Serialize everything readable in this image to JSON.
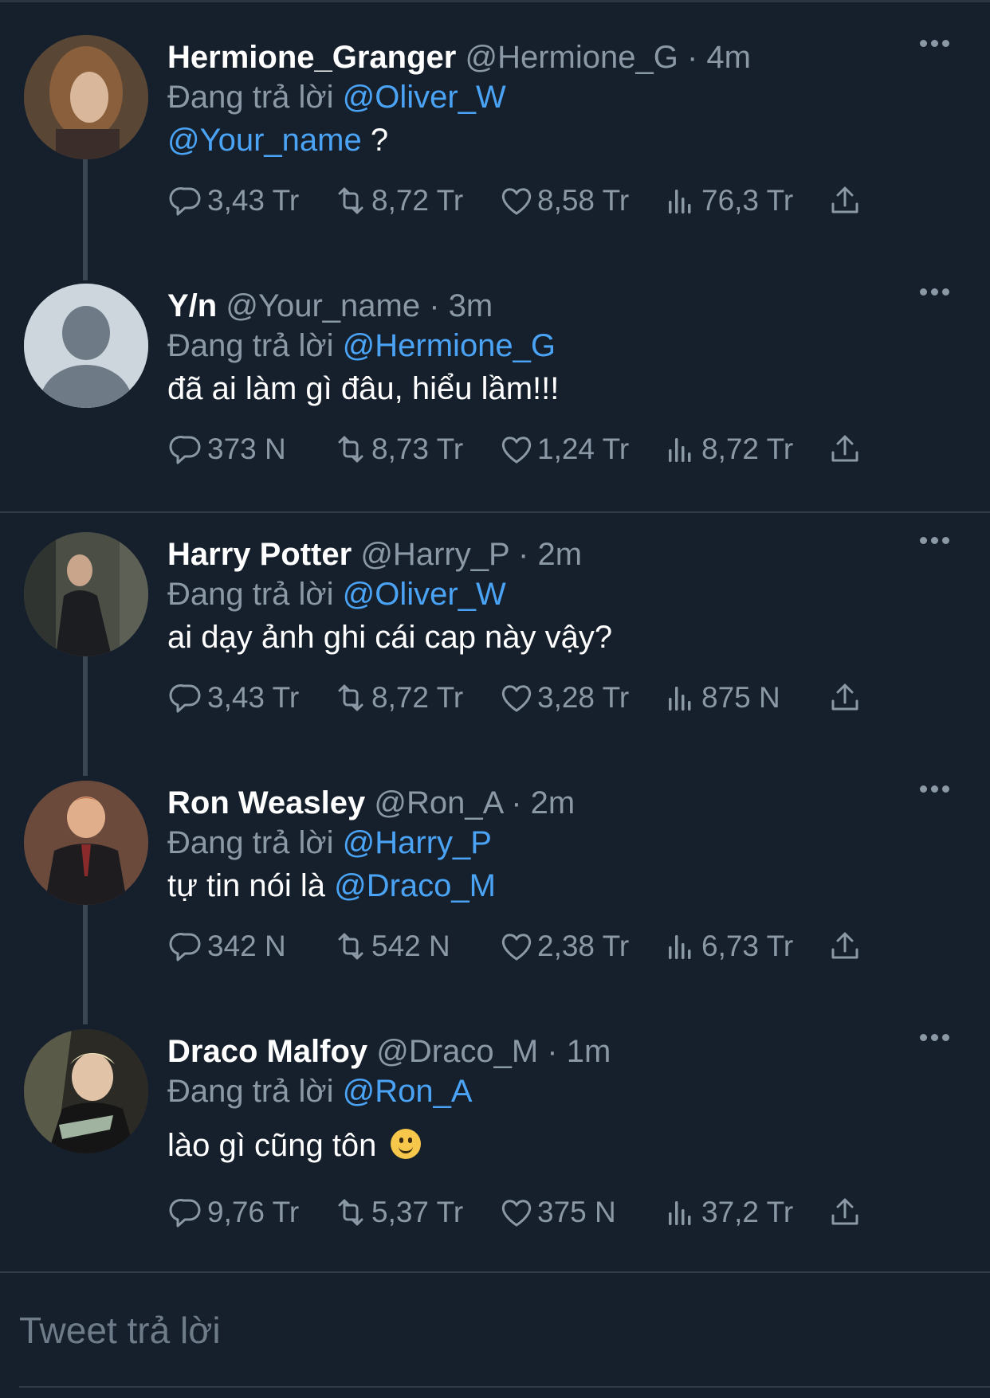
{
  "tweets": [
    {
      "name": "Hermione_Granger",
      "handle": "@Hermione_G",
      "time": "· 4m",
      "reply_prefix": "Đang trả lời",
      "reply_to": "@Oliver_W",
      "body_mention": "@Your_name",
      "body_text": " ?",
      "replies": "3,43 Tr",
      "retweets": "8,72 Tr",
      "likes": "8,58 Tr",
      "views": "76,3 Tr"
    },
    {
      "name": "Y/n",
      "handle": "@Your_name",
      "time": "· 3m",
      "reply_prefix": "Đang trả lời",
      "reply_to": "@Hermione_G",
      "body_text": "đã ai làm gì đâu, hiểu lầm!!!",
      "replies": "373 N",
      "retweets": "8,73 Tr",
      "likes": "1,24 Tr",
      "views": "8,72 Tr"
    },
    {
      "name": "Harry Potter",
      "handle": "@Harry_P",
      "time": "· 2m",
      "reply_prefix": "Đang trả lời",
      "reply_to": "@Oliver_W",
      "body_text": "ai dạy ảnh ghi cái cap này vậy?",
      "replies": "3,43 Tr",
      "retweets": "8,72 Tr",
      "likes": "3,28 Tr",
      "views": "875 N"
    },
    {
      "name": "Ron Weasley",
      "handle": "@Ron_A",
      "time": "· 2m",
      "reply_prefix": "Đang trả lời",
      "reply_to": "@Harry_P",
      "body_text": "tự tin nói là ",
      "body_mention": "@Draco_M",
      "replies": "342 N",
      "retweets": "542 N",
      "likes": "2,38 Tr",
      "views": "6,73 Tr"
    },
    {
      "name": "Draco Malfoy",
      "handle": "@Draco_M",
      "time": "· 1m",
      "reply_prefix": "Đang trả lời",
      "reply_to": "@Ron_A",
      "body_text": "lào gì cũng tôn",
      "body_emoji": "slightly-smiling-face-emoji",
      "replies": "9,76 Tr",
      "retweets": "5,37 Tr",
      "likes": "375 N",
      "views": "37,2 Tr"
    }
  ],
  "composer": {
    "placeholder": "Tweet trả lời"
  },
  "colors": {
    "background": "#16202c",
    "mention": "#4aa3f5",
    "muted": "#8b98a5"
  }
}
